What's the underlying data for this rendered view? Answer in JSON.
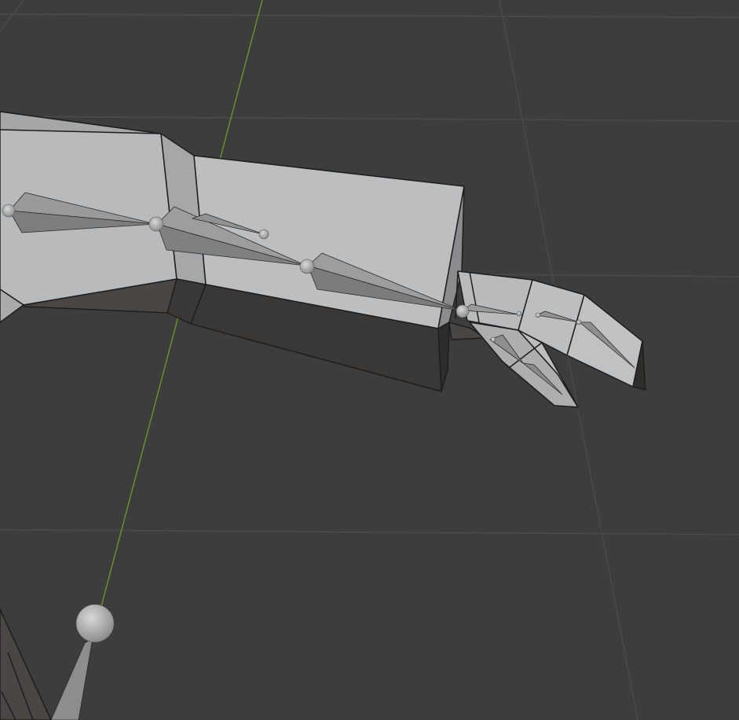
{
  "viewport": {
    "background_color": "#3d3d3d",
    "grid_line_color": "#4a4a4a",
    "y_axis_color": "#6a8f2e"
  },
  "mesh": {
    "light_face_color": "#b9babb",
    "mid_face_color": "#a9aaab",
    "dark_face_color": "#3a3836",
    "edge_color": "#1e1e1e"
  },
  "armature": {
    "bone_color": "#8a8a8a",
    "joint_color": "#b4b4b4"
  }
}
